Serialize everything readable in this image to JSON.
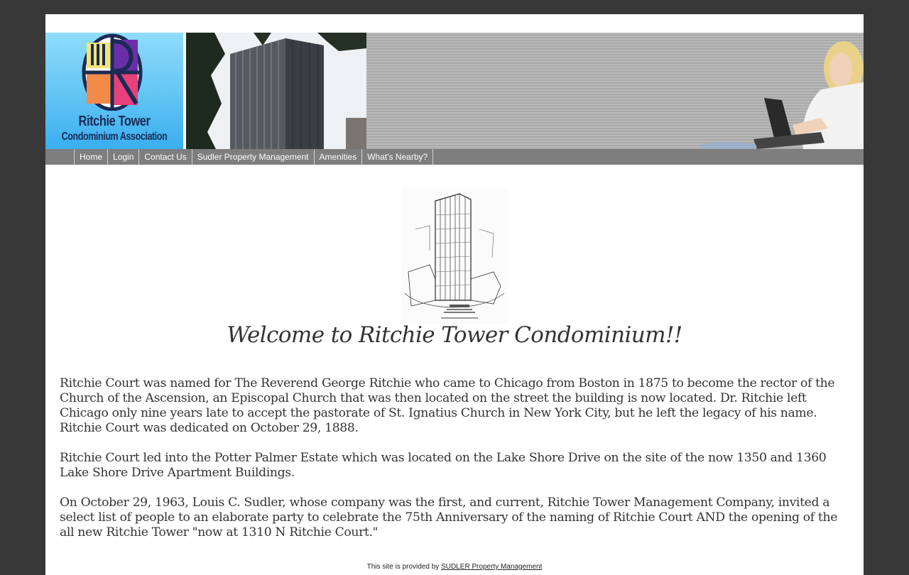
{
  "header": {
    "logo_line1": "Ritchie Tower",
    "logo_line2": "Condominium Association"
  },
  "nav": {
    "items": [
      "Home",
      "Login",
      "Contact Us",
      "Sudler Property Management",
      "Amenities",
      "What's Nearby?"
    ]
  },
  "main": {
    "welcome": "Welcome to Ritchie Tower Condominium!!",
    "paragraphs": [
      "Ritchie Court was named for The Reverend George Ritchie who came to Chicago from Boston in 1875 to become the rector of the Church of the Ascension, an Episcopal Church that was then located on the street the building is now located. Dr. Ritchie left Chicago only nine years late to accept the pastorate of St. Ignatius Church in New York City, but he left the legacy of his name. Ritchie Court was dedicated on October 29, 1888.",
      "Ritchie Court led into the Potter Palmer Estate which was located on the Lake Shore Drive on the site of the now 1350 and 1360 Lake Shore Drive Apartment Buildings.",
      "On October 29, 1963, Louis C. Sudler, whose company was the first, and current, Ritchie Tower Management Company, invited a select list of people to an elaborate party to celebrate the 75th Anniversary of the naming of Ritchie Court AND the opening of the all new Ritchie Tower \"now at 1310 N Ritchie Court.\""
    ]
  },
  "footer": {
    "prefix": "This site is provided by ",
    "link": "SUDLER Property Management"
  },
  "colors": {
    "page_bg": "#383838",
    "nav_bg": "#7e7e7e",
    "logo_blue": "#62c4f3",
    "text": "#333333"
  }
}
